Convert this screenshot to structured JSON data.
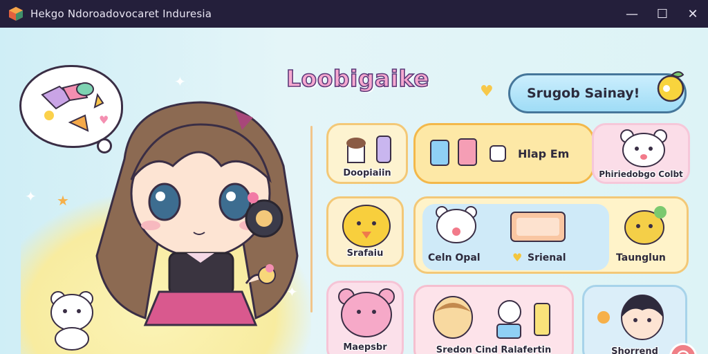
{
  "window": {
    "title": "Hekgo Ndoroadovocaret Induresia",
    "controls": {
      "minimize": "—",
      "maximize": "☐",
      "close": "✕"
    }
  },
  "header": {
    "logo_text": "Loobigaike",
    "search_label": "Srugob Sainay!"
  },
  "menu": {
    "items": [
      {
        "id": "c1",
        "label": "Doopiaiin"
      },
      {
        "id": "c2",
        "label": "Hlap Em"
      },
      {
        "id": "c3",
        "label": "Phiriedobgo Colbt"
      },
      {
        "id": "c4",
        "label": "Srafaiu"
      },
      {
        "id": "c5a",
        "label": "Celn Opal"
      },
      {
        "id": "c5b",
        "label": "Srienal"
      },
      {
        "id": "c5c",
        "label": "Taunglun"
      },
      {
        "id": "c6",
        "label": "Maepsbr"
      },
      {
        "id": "c7",
        "label": "Sredon Cind Ralafertin"
      },
      {
        "id": "c8",
        "label": "Shorrend"
      }
    ]
  },
  "colors": {
    "titlebar": "#241f3b",
    "accent_yellow": "#f3c877",
    "accent_pink": "#f6a8d0",
    "search_blue": "#9fdcf6"
  },
  "icons": [
    "app-icon",
    "minimize-icon",
    "maximize-icon",
    "close-icon",
    "lemon-search-icon",
    "heart-icon",
    "fab-icon"
  ]
}
